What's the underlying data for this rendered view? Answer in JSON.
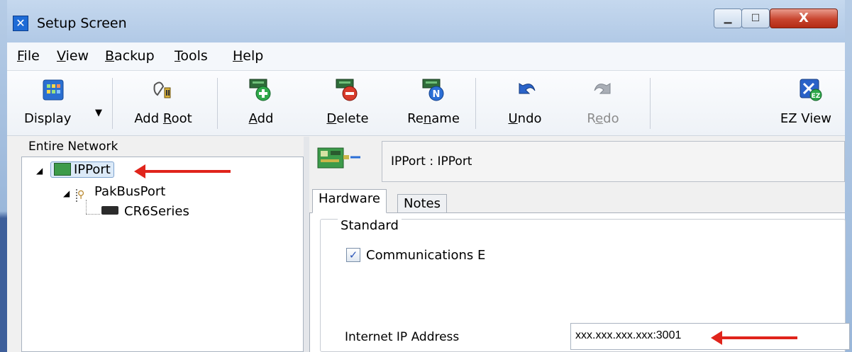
{
  "window": {
    "title": "Setup Screen"
  },
  "menu": [
    "File",
    "View",
    "Backup",
    "Tools",
    "Help"
  ],
  "toolbar": {
    "display": "Display",
    "add_root": "Add Root",
    "add": "Add",
    "delete": "Delete",
    "rename": "Rename",
    "undo": "Undo",
    "redo": "Redo",
    "ez_view": "EZ View"
  },
  "left_pane": {
    "title": "Entire Network",
    "tree": [
      {
        "label": "IPPort",
        "selected": true,
        "level": 0
      },
      {
        "label": "PakBusPort",
        "selected": false,
        "level": 1
      },
      {
        "label": "CR6Series",
        "selected": false,
        "level": 2
      }
    ]
  },
  "right_pane": {
    "header_title": "IPPort : IPPort",
    "tabs": [
      "Hardware",
      "Notes"
    ],
    "active_tab": "Hardware",
    "group_title": "Standard",
    "checkbox_label": "Communications E",
    "checkbox_checked": true,
    "ip_label": "Internet IP Address",
    "ip_value": "xxx.xxx.xxx.xxx:3001"
  },
  "colors": {
    "arrow": "#e0241b",
    "selection": "#dceaf8",
    "title_bar": "#b8cde8"
  }
}
